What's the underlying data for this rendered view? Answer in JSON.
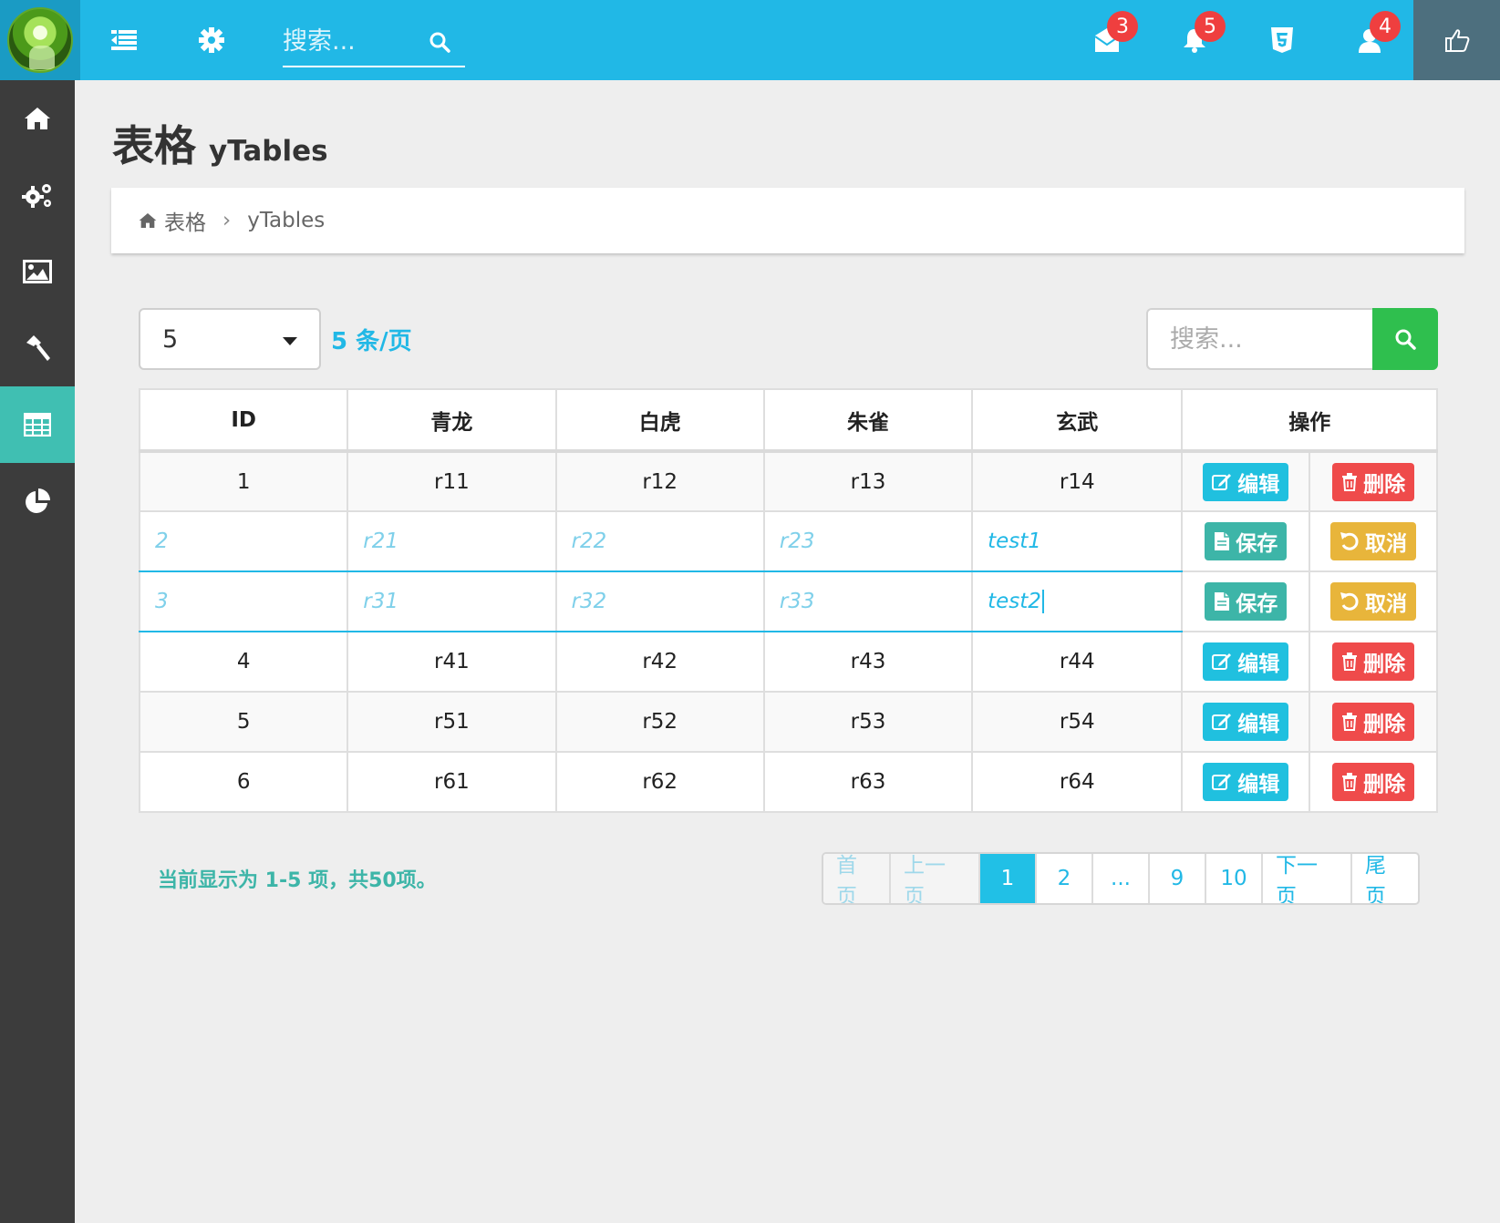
{
  "topbar": {
    "search_placeholder": "搜索...",
    "badges": {
      "mail": "3",
      "bell": "5",
      "user": "4"
    }
  },
  "sidebar": {
    "items": [
      {
        "icon": "home-icon"
      },
      {
        "icon": "gears-icon"
      },
      {
        "icon": "image-icon"
      },
      {
        "icon": "hammer-icon"
      },
      {
        "icon": "table-icon",
        "active": true
      },
      {
        "icon": "pie-chart-icon"
      }
    ]
  },
  "header": {
    "title": "表格",
    "subtitle": "yTables"
  },
  "breadcrumb": {
    "home": "表格",
    "current": "yTables"
  },
  "controls": {
    "page_size": "5",
    "per_page_label": "5 条/页",
    "search_placeholder": "搜索..."
  },
  "table": {
    "columns": [
      "ID",
      "青龙",
      "白虎",
      "朱雀",
      "玄武",
      "操作"
    ],
    "rows": [
      {
        "cells": [
          "1",
          "r11",
          "r12",
          "r13",
          "r14"
        ],
        "mode": "view"
      },
      {
        "cells": [
          "2",
          "r21",
          "r22",
          "r23",
          "test1"
        ],
        "mode": "edit"
      },
      {
        "cells": [
          "3",
          "r31",
          "r32",
          "r33",
          "test2"
        ],
        "mode": "edit"
      },
      {
        "cells": [
          "4",
          "r41",
          "r42",
          "r43",
          "r44"
        ],
        "mode": "view"
      },
      {
        "cells": [
          "5",
          "r51",
          "r52",
          "r53",
          "r54"
        ],
        "mode": "view"
      },
      {
        "cells": [
          "6",
          "r61",
          "r62",
          "r63",
          "r64"
        ],
        "mode": "view"
      }
    ],
    "actions": {
      "edit": "编辑",
      "delete": "删除",
      "save": "保存",
      "cancel": "取消"
    }
  },
  "footer": {
    "info": "当前显示为 1-5 项，共50项。",
    "pagination": [
      "首页",
      "上一页",
      "1",
      "2",
      "...",
      "9",
      "10",
      "下一页",
      "尾页"
    ]
  },
  "colors": {
    "topbar": "#21b8e6",
    "sidebar": "#3c3c3c",
    "sidebar_active": "#40bfb2",
    "search_button": "#2fbf4e",
    "edit_button": "#20c0df",
    "delete_button": "#ef4b4b",
    "save_button": "#3db5a8",
    "cancel_button": "#e8b53b"
  }
}
